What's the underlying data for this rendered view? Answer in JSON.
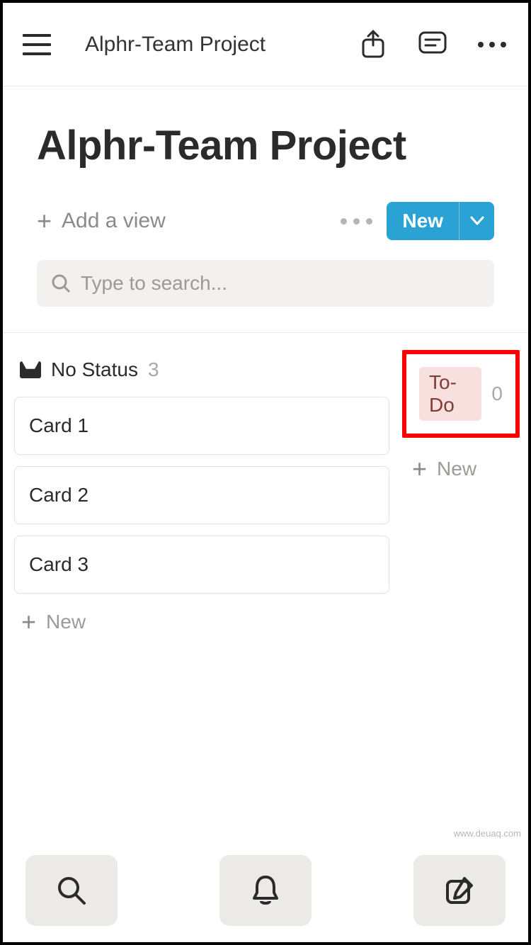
{
  "header": {
    "title": "Alphr-Team Project"
  },
  "page": {
    "title": "Alphr-Team Project"
  },
  "view_bar": {
    "add_view_label": "Add a view",
    "new_button_label": "New"
  },
  "search": {
    "placeholder": "Type to search..."
  },
  "board": {
    "columns": [
      {
        "name": "No Status",
        "count": "3",
        "cards": [
          "Card 1",
          "Card 2",
          "Card 3"
        ],
        "new_label": "New"
      },
      {
        "name": "To-Do",
        "count": "0",
        "cards": [],
        "new_label": "New",
        "tag_color": "#f7e0de"
      }
    ]
  },
  "watermark": "www.deuaq.com"
}
